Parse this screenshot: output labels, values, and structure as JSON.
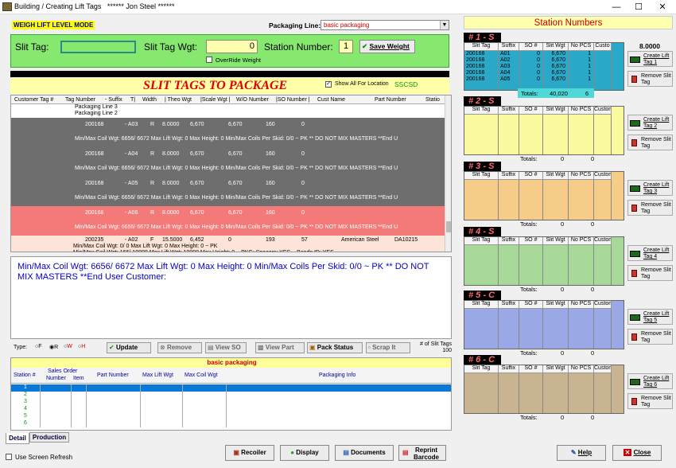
{
  "window": {
    "title": "Building / Creating Lift Tags",
    "user": "****** Jon Steel ******"
  },
  "mode_label": "WEIGH LIFT LEVEL MODE",
  "packaging_line": {
    "label": "Packaging Line:",
    "value": "basic packaging"
  },
  "slit": {
    "slit_tag_label": "Slit Tag:",
    "slit_tag_value": "",
    "wgt_label": "Slit Tag Wgt:",
    "wgt_value": "0",
    "station_label": "Station Number:",
    "station_value": "1",
    "save_label": "Save Weight",
    "override_label": "OverRide Weight"
  },
  "package": {
    "title": "SLIT TAGS TO PACKAGE",
    "show_all_label": "Show All For Location",
    "location": "SSCSD"
  },
  "grid": {
    "headers": [
      "Customer Tag #",
      "Tag Number",
      "- Suffix",
      "T|",
      "Width",
      "| Theo Wgt",
      "|Scale Wgt |",
      "W/O Number",
      "|SO Number |",
      "Cust Name",
      "Part Number",
      "Statio"
    ],
    "group_lines": [
      "Packaging Line 3",
      "Packaging Line 2"
    ],
    "rows": [
      {
        "style": "gray",
        "tag": "200168",
        "suffix": "A03",
        "t": "R",
        "width": "8.0000",
        "theo": "6,670",
        "scale": "6,670",
        "wo": "160",
        "so": "0",
        "cust": "",
        "part": "",
        "note": "Min/Max Coil Wgt: 6656/ 6672 Max Lift Wgt: 0  Max Height: 0  Min/Max Coils Per Skid: 0/0 ~ PK ** DO NOT MIX MASTERS **End U"
      },
      {
        "style": "gray",
        "tag": "200168",
        "suffix": "A04",
        "t": "R",
        "width": "8.0000",
        "theo": "6,670",
        "scale": "6,670",
        "wo": "160",
        "so": "0",
        "cust": "",
        "part": "",
        "note": "Min/Max Coil Wgt: 6656/ 6672 Max Lift Wgt: 0  Max Height: 0  Min/Max Coils Per Skid: 0/0 ~ PK ** DO NOT MIX MASTERS **End U"
      },
      {
        "style": "gray",
        "tag": "200168",
        "suffix": "A05",
        "t": "R",
        "width": "8.0000",
        "theo": "6,670",
        "scale": "6,670",
        "wo": "160",
        "so": "0",
        "cust": "",
        "part": "",
        "note": "Min/Max Coil Wgt: 6656/ 6672 Max Lift Wgt: 0  Max Height: 0  Min/Max Coils Per Skid: 0/0 ~ PK ** DO NOT MIX MASTERS **End U"
      },
      {
        "style": "red",
        "tag": "200168",
        "suffix": "A06",
        "t": "R",
        "width": "8.0000",
        "theo": "6,670",
        "scale": "6,670",
        "wo": "160",
        "so": "0",
        "cust": "",
        "part": "",
        "note": "Min/Max Coil Wgt: 6656/ 6672 Max Lift Wgt: 0  Max Height: 0  Min/Max Coils Per Skid: 0/0 ~ PK ** DO NOT MIX MASTERS **End U"
      },
      {
        "style": "pale",
        "tag": "200235",
        "suffix": "A02",
        "t": "F",
        "width": "15.5000",
        "theo": "6,452",
        "scale": "0",
        "wo": "193",
        "so": "57",
        "cust": "American Steel",
        "part": "DA10215",
        "note": "Min/Max Coil Wgt: 0/ 0 Max Lift Wgt: 0 Max Height: 0 ~ PK",
        "note2": "Min/Max Coil Wgt: 166/ 10000 Max Lift Wgt: 10000  Max Height: 0 ~ PKG: Spacers: YES ~ Bands ID: YES"
      }
    ]
  },
  "info_text": "Min/Max Coil Wgt: 6656/ 6672 Max Lift Wgt: 0  Max Height: 0  Min/Max Coils Per Skid: 0/0 ~ PK ** DO NOT MIX MASTERS **End User Customer:",
  "toolbar": {
    "type_label": "Type:",
    "types": [
      "F",
      "R",
      "W",
      "H"
    ],
    "update": "Update",
    "remove": "Remove",
    "view_so": "View SO",
    "view_part": "View Part",
    "pack_status": "Pack Status",
    "scrap_it": "Scrap It",
    "slit_tags_label": "# of Slit Tags",
    "slit_tags_count": "100"
  },
  "lower_grid": {
    "title": "basic packaging",
    "headers": [
      "Station #",
      "Sales Order Number",
      "Item",
      "Part Number",
      "Max Lift Wgt",
      "Max Coil Wgt",
      "Packaging Info"
    ],
    "sales_order_top": "Sales Order",
    "number": "Number",
    "stations": [
      "1",
      "2",
      "3",
      "4",
      "5",
      "6"
    ]
  },
  "tabs": [
    "Detail",
    "Production"
  ],
  "screen_refresh_label": "Use Screen Refresh",
  "bottom_buttons": {
    "recoiler": "Recoiler",
    "display": "Display",
    "documents": "Documents",
    "reprint": "Reprint",
    "barcode": "Barcode",
    "help": "Help",
    "close": "Close"
  },
  "stations_title": "Station Numbers",
  "weight_display": "8.0000",
  "station_headers": [
    "Slit Tag",
    "Suffix",
    "SO #",
    "Slit Wgt",
    "No PCS",
    "Custo"
  ],
  "stations": [
    {
      "name": "# 1 - S",
      "color": "#2aa8c8",
      "rows": [
        [
          "200168",
          "A01",
          "0",
          "6,670",
          "1"
        ],
        [
          "200168",
          "A02",
          "0",
          "6,670",
          "1"
        ],
        [
          "200168",
          "A03",
          "0",
          "6,670",
          "1"
        ],
        [
          "200168",
          "A04",
          "0",
          "6,670",
          "1"
        ],
        [
          "200168",
          "A05",
          "0",
          "6,670",
          "1"
        ]
      ],
      "totals_label": "Totals:",
      "total_wgt": "40,020",
      "total_pcs": "6",
      "create": "Create Lift",
      "create2": "Tag 1",
      "remove": "Remove Slit",
      "remove2": "Tag"
    },
    {
      "name": "# 2 - S",
      "color": "#fbfaa0",
      "rows": [],
      "totals_label": "Totals:",
      "total_wgt": "0",
      "total_pcs": "0",
      "create": "Create Lift",
      "create2": "Tag 2",
      "remove": "Remove Slit",
      "remove2": "Tag"
    },
    {
      "name": "# 3 - S",
      "color": "#f6cd88",
      "rows": [],
      "totals_label": "Totals:",
      "total_wgt": "0",
      "total_pcs": "0",
      "create": "Create Lift",
      "create2": "Tag 3",
      "remove": "Remove Slit",
      "remove2": "Tag"
    },
    {
      "name": "# 4 - S",
      "color": "#a8d89a",
      "rows": [],
      "totals_label": "Totals:",
      "total_wgt": "0",
      "total_pcs": "0",
      "create": "Create Lift",
      "create2": "Tag 4",
      "remove": "Remove Slit",
      "remove2": "Tag"
    },
    {
      "name": "# 5 - C",
      "color": "#9aa8e6",
      "rows": [],
      "totals_label": "Totals:",
      "total_wgt": "0",
      "total_pcs": "0",
      "create": "Create Lift",
      "create2": "Tag 5",
      "remove": "Remove Slit",
      "remove2": "Tag"
    },
    {
      "name": "# 6 - C",
      "color": "#c8b490",
      "rows": [],
      "totals_label": "Totals:",
      "total_wgt": "0",
      "total_pcs": "0",
      "create": "Create Lift",
      "create2": "Tag 6",
      "remove": "Remove Slit",
      "remove2": "Tag"
    }
  ],
  "station_headers_alt": [
    "Slit Tag",
    "Suffix",
    "SO #",
    "Slit Wgt",
    "No PCS",
    "Customer"
  ]
}
